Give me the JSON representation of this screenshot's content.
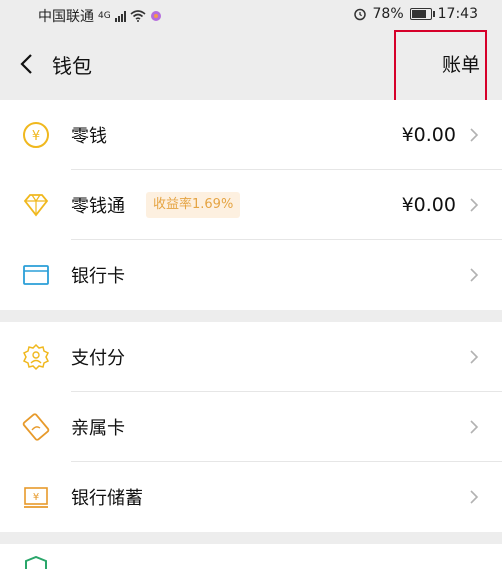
{
  "status_bar": {
    "carrier": "中国联通",
    "network": "4G",
    "battery": "78%",
    "time": "17:43"
  },
  "header": {
    "title": "钱包",
    "bill_label": "账单"
  },
  "sections": [
    {
      "items": [
        {
          "label": "零钱",
          "value": "¥0.00",
          "icon": "yuan-coin-icon"
        },
        {
          "label": "零钱通",
          "badge": "收益率1.69%",
          "value": "¥0.00",
          "icon": "diamond-icon"
        },
        {
          "label": "银行卡",
          "icon": "bank-card-icon"
        }
      ]
    },
    {
      "items": [
        {
          "label": "支付分",
          "icon": "pay-score-icon"
        },
        {
          "label": "亲属卡",
          "icon": "family-card-icon"
        },
        {
          "label": "银行储蓄",
          "icon": "bank-savings-icon"
        }
      ]
    }
  ],
  "colors": {
    "background": "#ededed",
    "gold": "#f0b81e",
    "blue": "#2a9fd8",
    "orange": "#e79a2b",
    "badge_bg": "#fdf0e0",
    "badge_text": "#e5a443",
    "highlight": "#d6002a",
    "green": "#2aa66a"
  }
}
